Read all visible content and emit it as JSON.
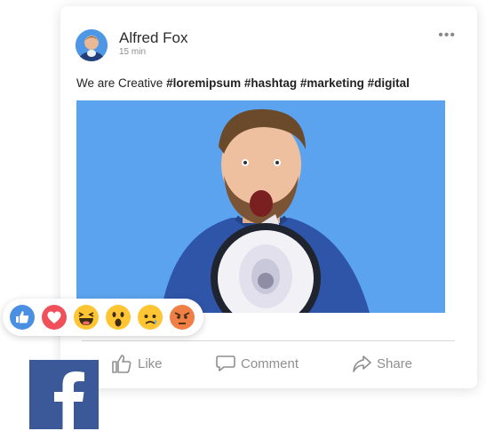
{
  "post": {
    "author": "Alfred Fox",
    "time": "15 min",
    "caption_plain": "We are Creative",
    "caption_tags": "#loremipsum #hashtag #marketing #digital"
  },
  "actions": {
    "like": "Like",
    "comment": "Comment",
    "share": "Share"
  },
  "reactions": [
    "like-icon",
    "love-icon",
    "haha-icon",
    "wow-icon",
    "sad-icon",
    "angry-icon"
  ],
  "colors": {
    "photo_bg": "#5ba3ee",
    "facebook_blue": "#3b5999",
    "like_blue": "#4a90e2",
    "love_red": "#f0505a",
    "emoji_yellow": "#ffc533",
    "angry_orange": "#f07f45",
    "action_gray": "#8f8f8f"
  }
}
